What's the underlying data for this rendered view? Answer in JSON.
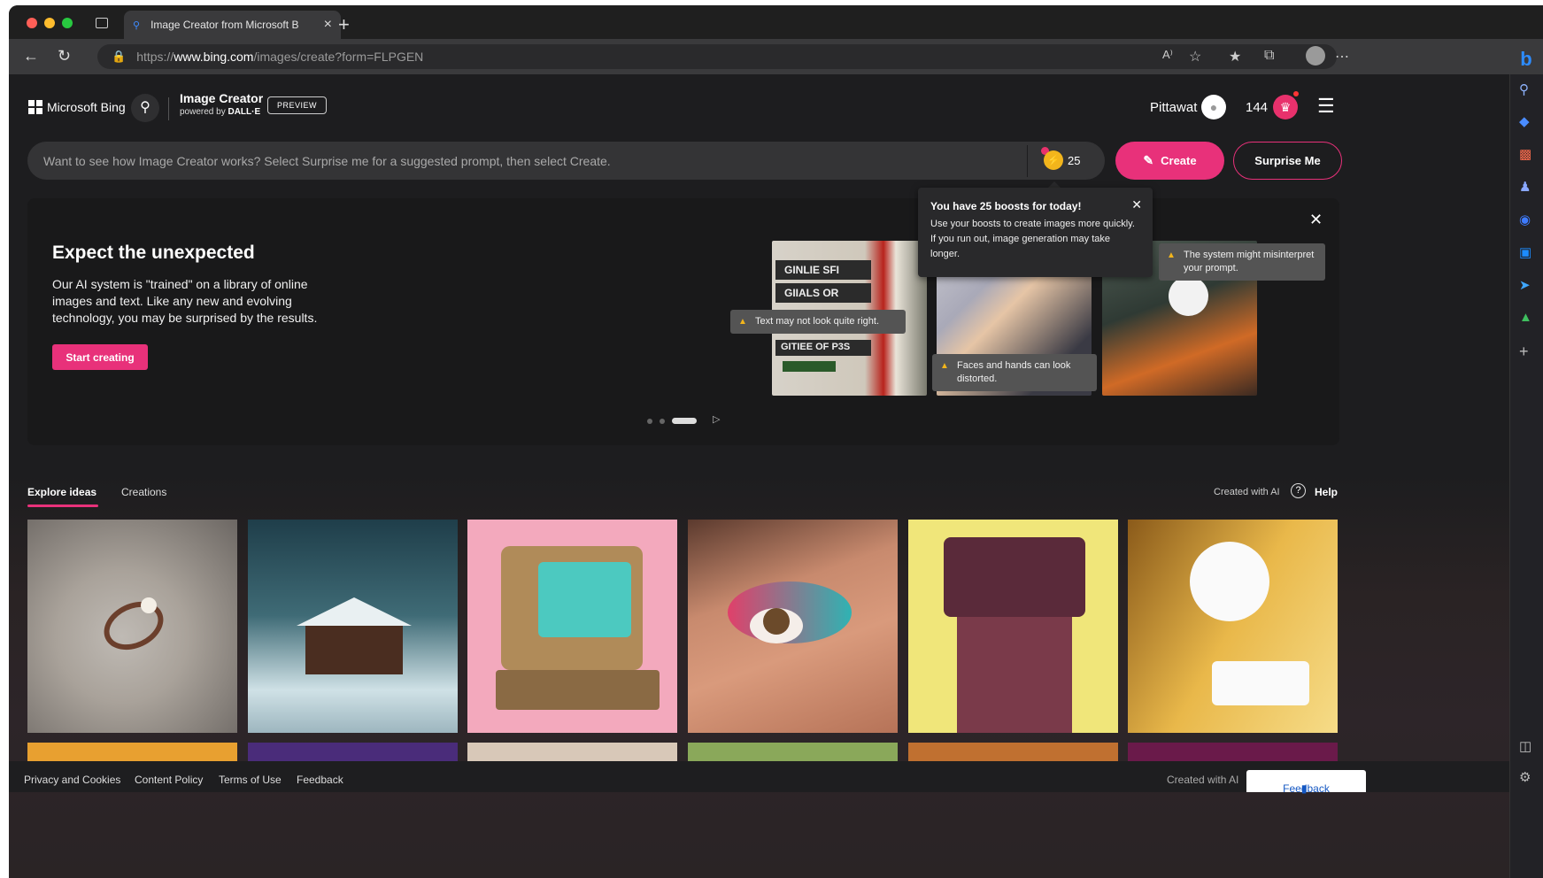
{
  "browser": {
    "tab_title": "Image Creator from Microsoft B",
    "url_prefix": "https://",
    "url_domain": "www.bing.com",
    "url_path": "/images/create?form=FLPGEN"
  },
  "header": {
    "brand": "Microsoft Bing",
    "product_title": "Image Creator",
    "powered_by": "powered by ",
    "powered_engine": "DALL·E",
    "preview_badge": "PREVIEW",
    "username": "Pittawat",
    "points": "144"
  },
  "prompt": {
    "placeholder": "Want to see how Image Creator works? Select Surprise me for a suggested prompt, then select Create.",
    "boosts": "25",
    "create_label": "Create",
    "surprise_label": "Surprise Me"
  },
  "tooltip": {
    "title": "You have 25 boosts for today!",
    "body": "Use your boosts to create images more quickly. If you run out, image generation may take longer."
  },
  "hero": {
    "title": "Expect the unexpected",
    "body": "Our AI system is \"trained\" on a library of online images and text. Like any new and evolving technology, you may be surprised by the results.",
    "cta": "Start creating",
    "warning_text": "Text may not look quite right.",
    "warning_faces": "Faces and hands can look distorted.",
    "warning_prompt": "The system might misinterpret your prompt.",
    "sign_lines": [
      "GINLIE SFI",
      "GIIALS OR",
      "GITIEE OF P3S"
    ]
  },
  "tabs": {
    "explore": "Explore ideas",
    "creations": "Creations",
    "created_with_ai": "Created with AI",
    "help": "Help"
  },
  "footer": {
    "privacy": "Privacy and Cookies",
    "content_policy": "Content Policy",
    "terms": "Terms of Use",
    "feedback": "Feedback",
    "created_with_ai": "Created with AI",
    "feedback_button": "Feedback"
  },
  "colors": {
    "accent": "#e8317a",
    "boost": "#f2b51c",
    "page_bg": "#1d1d1f"
  }
}
